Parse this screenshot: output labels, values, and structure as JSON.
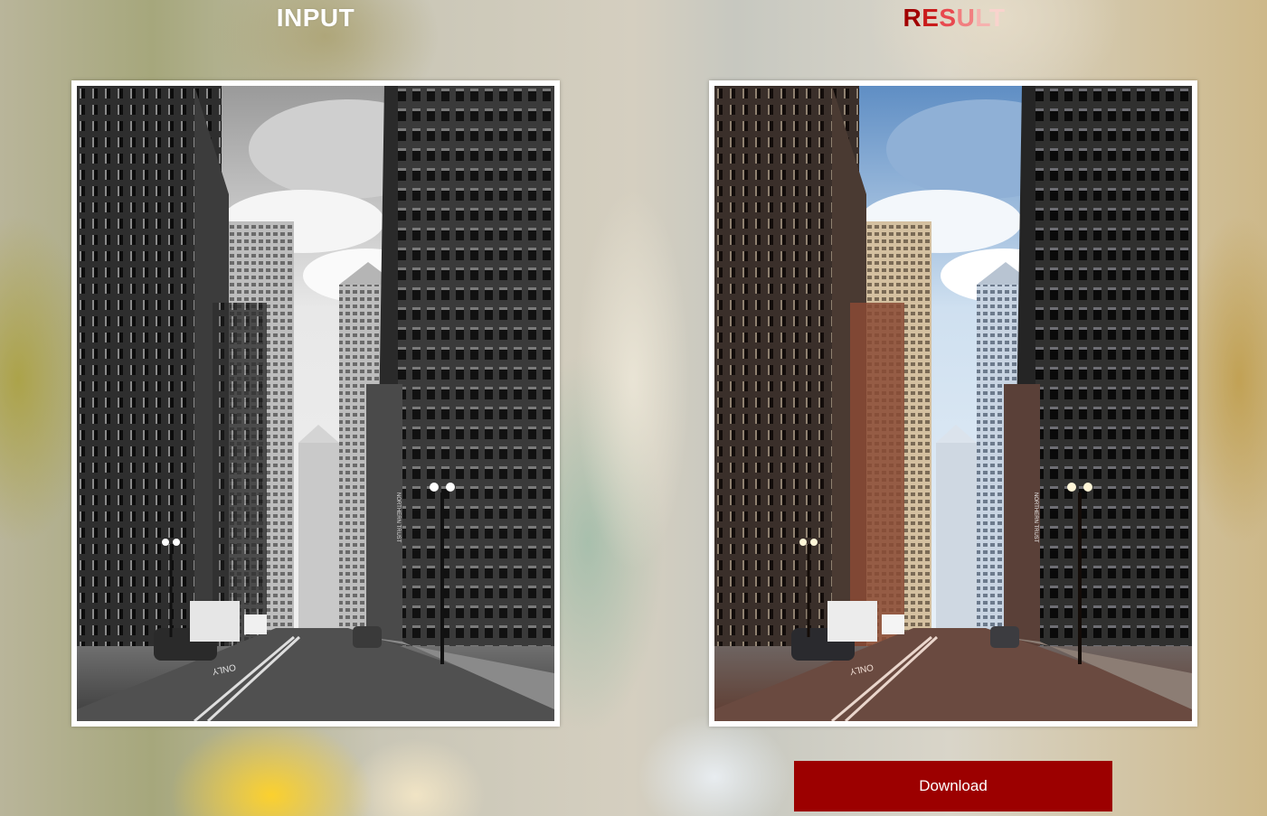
{
  "input_panel": {
    "title": "INPUT",
    "image_description_icon": "grayscale-city-street-photo"
  },
  "result_panel": {
    "title_letters": [
      {
        "char": "R",
        "color": "#a10000"
      },
      {
        "char": "E",
        "color": "#c91b1b"
      },
      {
        "char": "S",
        "color": "#e8494f"
      },
      {
        "char": "U",
        "color": "#f17f80"
      },
      {
        "char": "L",
        "color": "#f6b1ae"
      },
      {
        "char": "T",
        "color": "#f9d3cd"
      }
    ],
    "image_description_icon": "colorized-city-street-photo"
  },
  "download_button": {
    "label": "Download",
    "color": "#9c0000"
  },
  "street_signs": {
    "left_sign": "ONLY",
    "building_sign": "NORTHERN TRUST"
  }
}
